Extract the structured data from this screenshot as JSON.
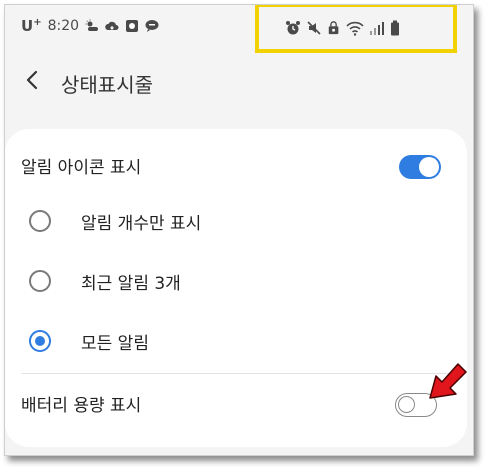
{
  "status_bar": {
    "carrier": "U",
    "carrier_sup": "+",
    "time": "8:20"
  },
  "header": {
    "title": "상태표시줄"
  },
  "settings": {
    "notification_icons_label": "알림 아이콘 표시",
    "notification_icons_enabled": true,
    "options": [
      {
        "label": "알림 개수만 표시",
        "selected": false
      },
      {
        "label": "최근 알림 3개",
        "selected": false
      },
      {
        "label": "모든 알림",
        "selected": true
      }
    ],
    "battery_label": "배터리 용량 표시",
    "battery_enabled": false
  },
  "colors": {
    "accent": "#2f7de1",
    "highlight_box": "#f2d100",
    "annotation_arrow": "#e0161c"
  },
  "icons": {
    "status_left": [
      "weather-icon",
      "cloud-icon",
      "app-icon",
      "talk-icon"
    ],
    "status_right": [
      "alarm-icon",
      "mute-icon",
      "lock-icon",
      "wifi-icon",
      "signal-icon",
      "battery-icon"
    ]
  }
}
